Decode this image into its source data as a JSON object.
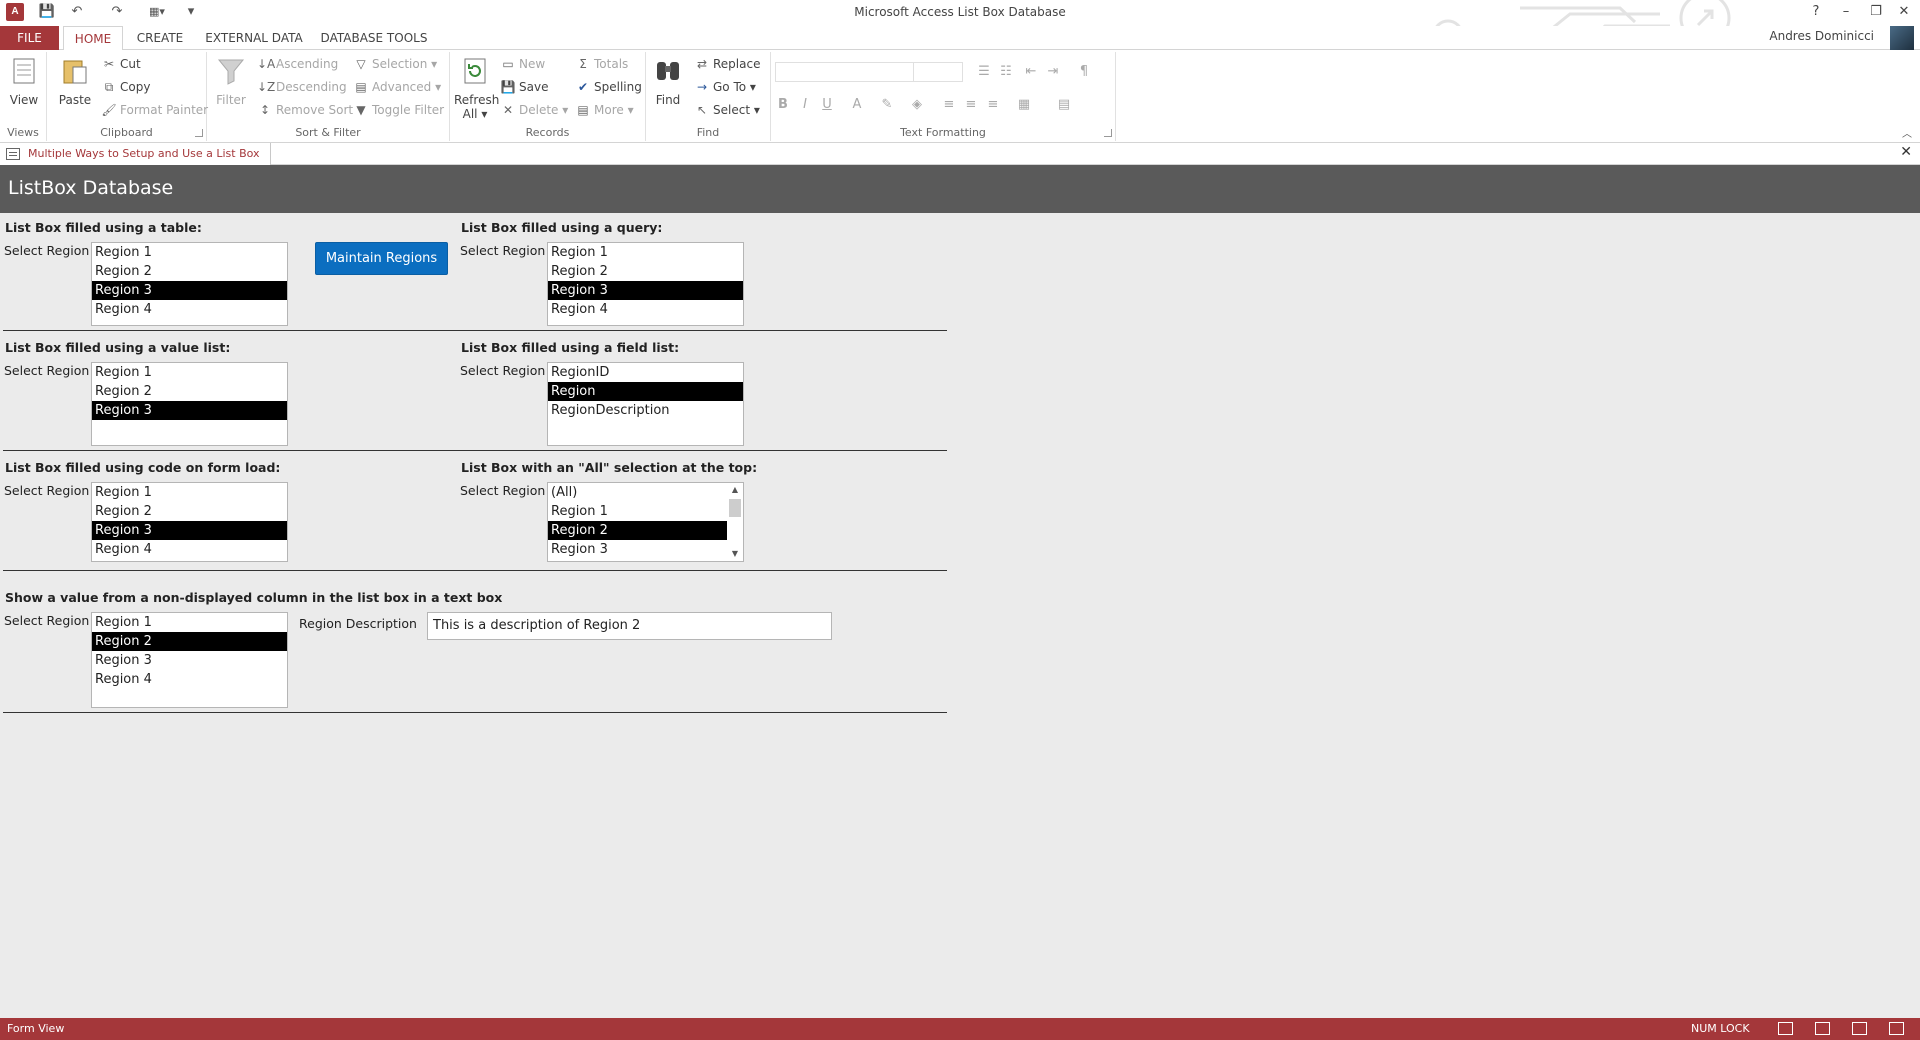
{
  "window": {
    "title": "Microsoft Access List Box Database",
    "app_icon": "A",
    "help": "?",
    "minimize": "–",
    "restore": "❐",
    "close": "✕"
  },
  "qat": {
    "save": "💾",
    "undo": "↶",
    "redo": "↷",
    "customize": "▾"
  },
  "ribbon_tabs": {
    "file": "FILE",
    "home": "HOME",
    "create": "CREATE",
    "external": "EXTERNAL DATA",
    "dbtools": "DATABASE TOOLS",
    "user": "Andres Dominicci"
  },
  "ribbon": {
    "views": {
      "view": "View",
      "label": "Views"
    },
    "clipboard": {
      "paste": "Paste",
      "cut": "Cut",
      "copy": "Copy",
      "format_painter": "Format Painter",
      "label": "Clipboard"
    },
    "sort_filter": {
      "filter": "Filter",
      "ascending": "Ascending",
      "descending": "Descending",
      "remove_sort": "Remove Sort",
      "selection": "Selection",
      "advanced": "Advanced",
      "toggle_filter": "Toggle Filter",
      "label": "Sort & Filter"
    },
    "records": {
      "refresh": "Refresh",
      "refresh2": "All",
      "new": "New",
      "save": "Save",
      "delete": "Delete",
      "totals": "Totals",
      "spelling": "Spelling",
      "more": "More",
      "label": "Records"
    },
    "find": {
      "find": "Find",
      "replace": "Replace",
      "goto": "Go To",
      "select": "Select",
      "label": "Find"
    },
    "text_formatting": {
      "bold": "B",
      "italic": "I",
      "underline": "U",
      "font_color": "A",
      "label": "Text Formatting"
    }
  },
  "doc_tab": {
    "title": "Multiple Ways to Setup and Use a List Box",
    "close": "✕"
  },
  "form": {
    "header": "ListBox Database",
    "maintain_button": "Maintain Regions",
    "select_label": "Select Region",
    "sections": {
      "table": "List Box filled using a table:",
      "query": "List Box filled using a query:",
      "value_list": "List Box filled using a value list:",
      "field_list": "List Box filled using a field list:",
      "code": "List Box filled using code on form load:",
      "all": "List Box with an \"All\" selection at the top:",
      "nondisplayed": "Show a value from a non-displayed column in the list box in a text box"
    },
    "lists": {
      "table": {
        "items": [
          "Region 1",
          "Region 2",
          "Region 3",
          "Region 4"
        ],
        "selected": 2
      },
      "query": {
        "items": [
          "Region 1",
          "Region 2",
          "Region 3",
          "Region 4"
        ],
        "selected": 2
      },
      "value_list": {
        "items": [
          "Region 1",
          "Region 2",
          "Region 3"
        ],
        "selected": 2
      },
      "field_list": {
        "items": [
          "RegionID",
          "Region",
          "RegionDescription"
        ],
        "selected": 1
      },
      "code": {
        "items": [
          "Region 1",
          "Region 2",
          "Region 3",
          "Region 4"
        ],
        "selected": 2
      },
      "all": {
        "items": [
          "(All)",
          "Region 1",
          "Region 2",
          "Region 3"
        ],
        "selected": 2
      },
      "nondisplayed": {
        "items": [
          "Region 1",
          "Region 2",
          "Region 3",
          "Region 4"
        ],
        "selected": 1
      }
    },
    "region_description_label": "Region Description",
    "region_description_value": "This is a description of Region 2"
  },
  "status": {
    "view": "Form View",
    "num_lock": "NUM LOCK"
  },
  "colors": {
    "accent": "#a4373a",
    "button_blue": "#0b6ec0",
    "header_bg": "#5a5a5a"
  }
}
